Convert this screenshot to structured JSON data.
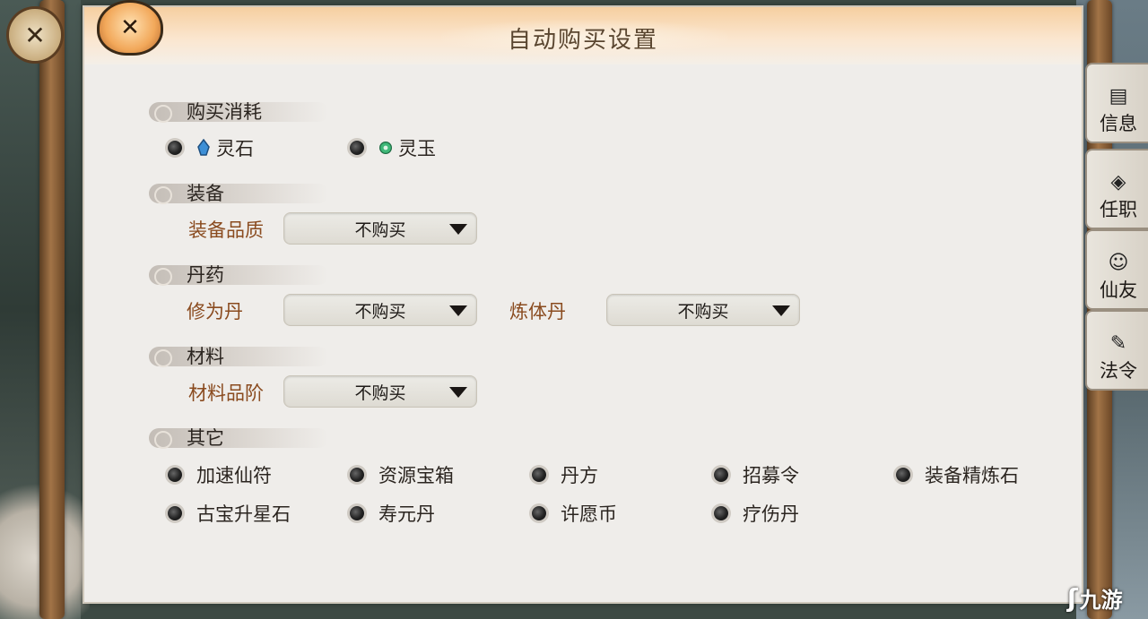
{
  "title": "自动购买设置",
  "sections": {
    "cost": {
      "label": "购买消耗",
      "options": [
        {
          "label": "灵石",
          "icon": "blue-spirit-stone-icon"
        },
        {
          "label": "灵玉",
          "icon": "green-jade-icon"
        }
      ]
    },
    "equipment": {
      "label": "装备",
      "quality_label": "装备品质",
      "quality_value": "不购买"
    },
    "elixir": {
      "label": "丹药",
      "xiuwei_label": "修为丹",
      "xiuwei_value": "不购买",
      "lianti_label": "炼体丹",
      "lianti_value": "不购买"
    },
    "material": {
      "label": "材料",
      "grade_label": "材料品阶",
      "grade_value": "不购买"
    },
    "other": {
      "label": "其它",
      "items": [
        "加速仙符",
        "资源宝箱",
        "丹方",
        "招募令",
        "装备精炼石",
        "古宝升星石",
        "寿元丹",
        "许愿币",
        "疗伤丹"
      ]
    }
  },
  "side_tabs": [
    {
      "label": "信息",
      "icon": "scroll-icon"
    },
    {
      "label": "任职",
      "icon": "seal-icon"
    },
    {
      "label": "仙友",
      "icon": "person-icon"
    },
    {
      "label": "法令",
      "icon": "decree-icon"
    }
  ],
  "watermark": "九游",
  "colors": {
    "field_label": "#8a4b1f",
    "header": "#f6cfa0",
    "panel": "#efedea"
  }
}
